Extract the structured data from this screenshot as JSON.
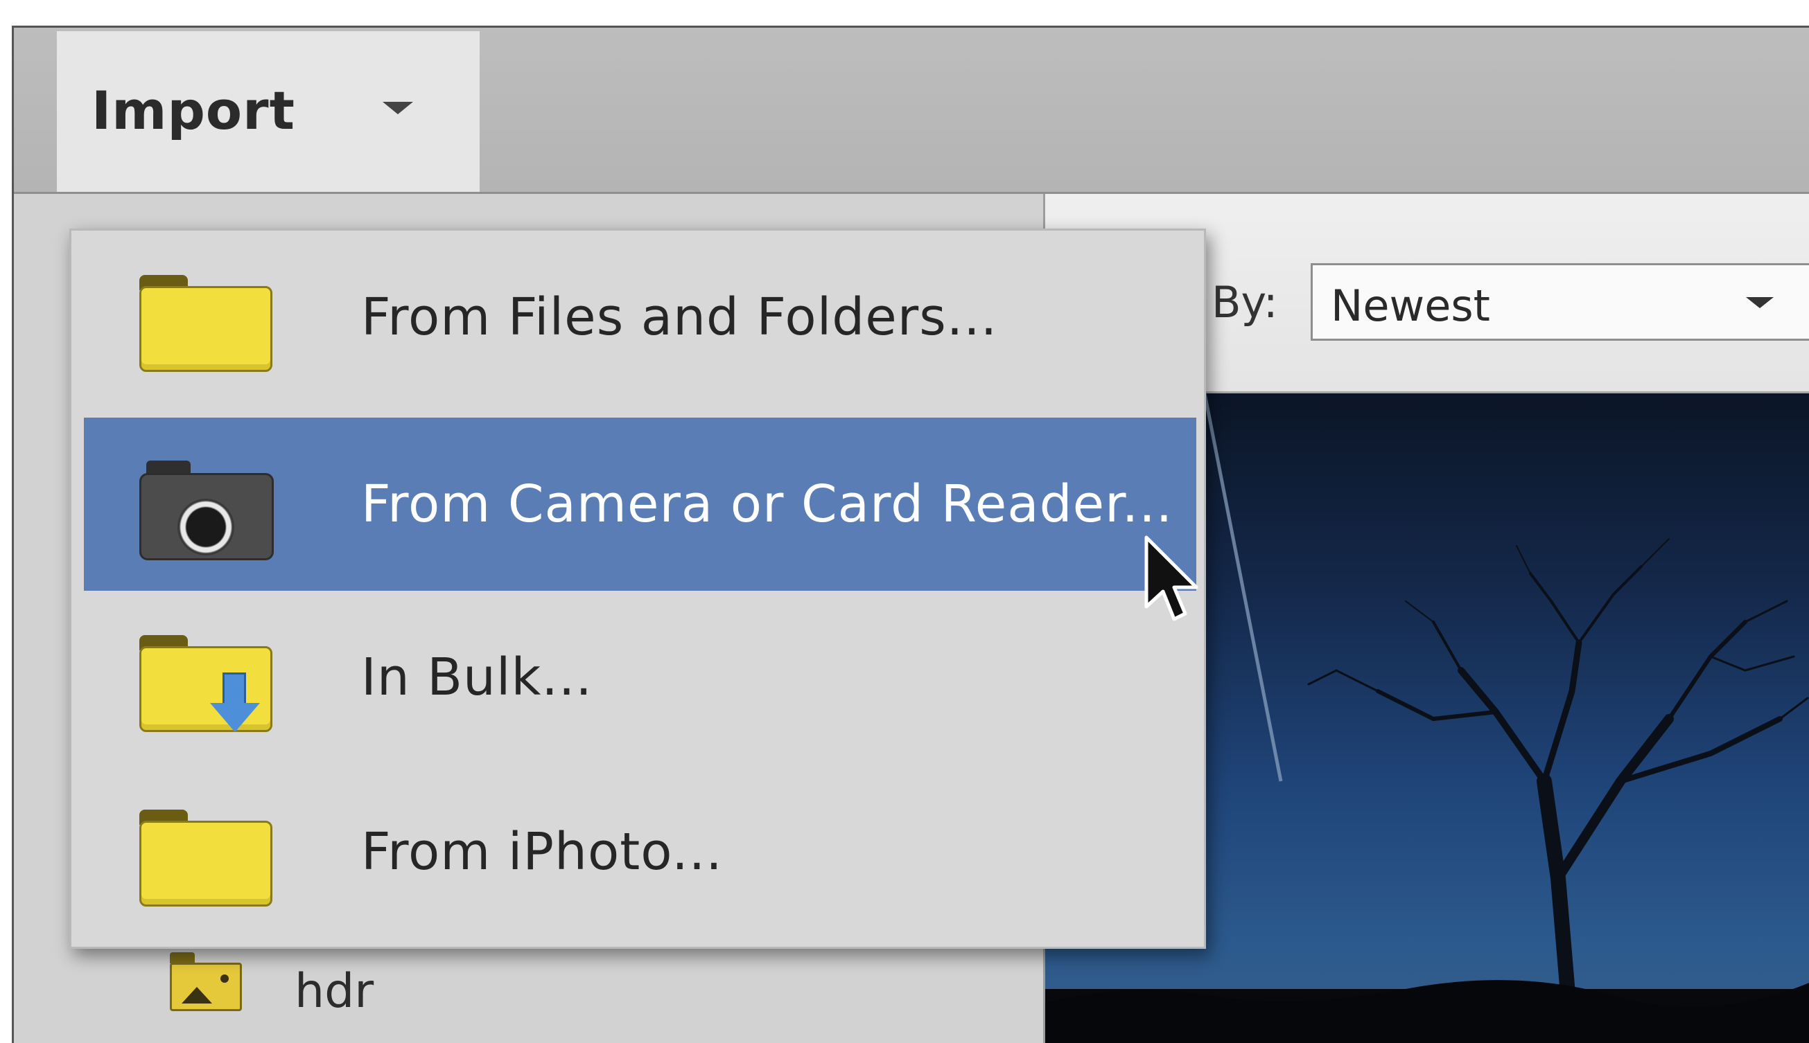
{
  "toolbar": {
    "import_label": "Import"
  },
  "sort": {
    "label": "By:",
    "value": "Newest"
  },
  "import_menu": {
    "items": [
      {
        "label": "From Files and Folders...",
        "icon": "folder-icon",
        "highlighted": false
      },
      {
        "label": "From Camera or Card Reader...",
        "icon": "camera-icon",
        "highlighted": true
      },
      {
        "label": "In Bulk...",
        "icon": "folder-download-icon",
        "highlighted": false
      },
      {
        "label": "From iPhoto...",
        "icon": "folder-icon",
        "highlighted": false
      }
    ]
  },
  "sidebar": {
    "albums": [
      {
        "label": "hdr",
        "icon": "image-album-icon"
      }
    ]
  },
  "colors": {
    "highlight": "#5a7db6",
    "menu_bg": "#d8d8d8",
    "folder": "#f2df3e",
    "arrow": "#4d8fd8"
  }
}
